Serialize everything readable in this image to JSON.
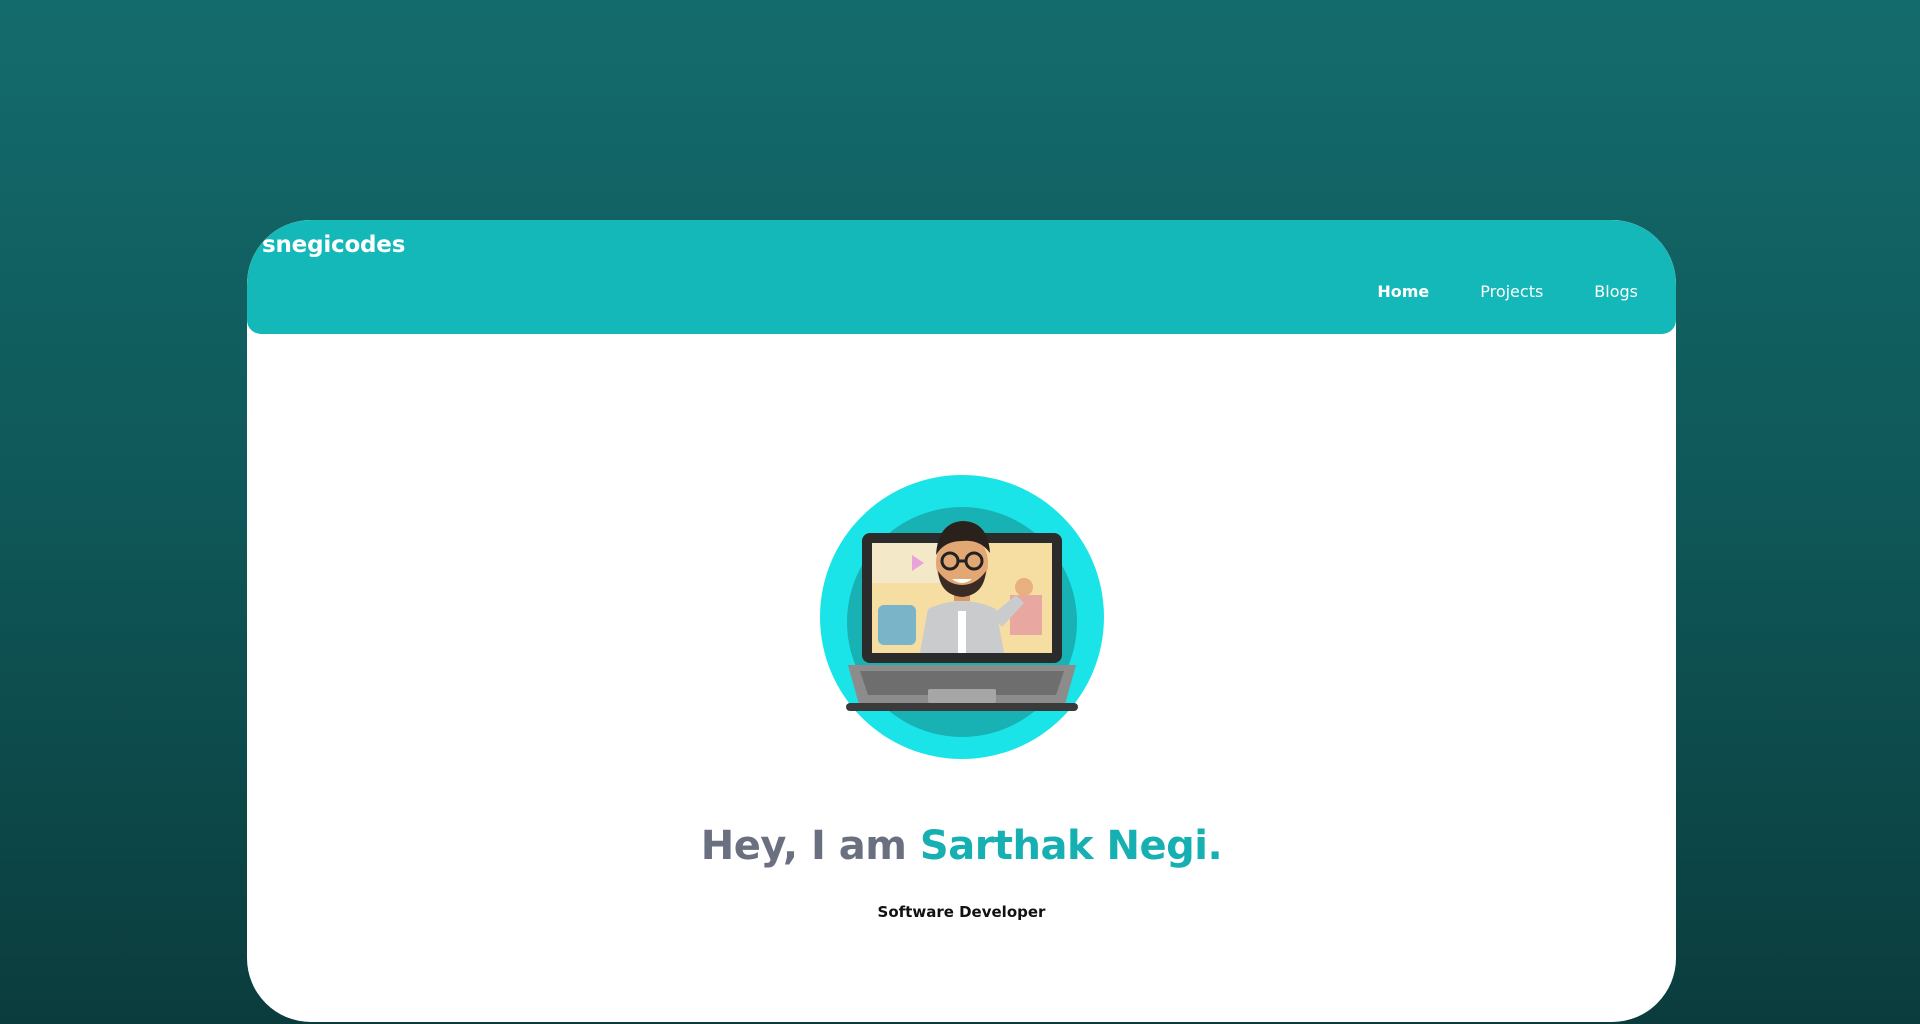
{
  "brand": {
    "name": "snegicodes"
  },
  "nav": {
    "items": [
      {
        "label": "Home",
        "active": true
      },
      {
        "label": "Projects",
        "active": false
      },
      {
        "label": "Blogs",
        "active": false
      }
    ]
  },
  "hero": {
    "greeting": "Hey, I am ",
    "name": "Sarthak Negi.",
    "subtitle": "Software Developer"
  },
  "colors": {
    "accent": "#14b8b9",
    "avatar_ring": "#1be4e8",
    "headline": "#6b7080"
  }
}
